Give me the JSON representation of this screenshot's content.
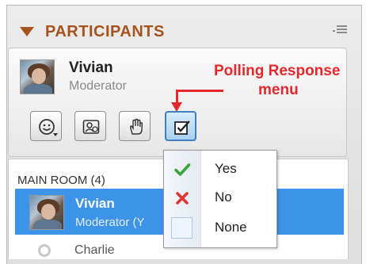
{
  "panel": {
    "title": "PARTICIPANTS",
    "colors": {
      "title": "#a5521d",
      "selection": "#3d93e8",
      "annotation": "#e4282c"
    }
  },
  "current_user": {
    "name": "Vivian",
    "role": "Moderator"
  },
  "annotation": {
    "line1": "Polling Response",
    "line2": "menu"
  },
  "toolbar": {
    "buttons": [
      {
        "icon": "emoticon-icon",
        "has_dropdown": true
      },
      {
        "icon": "profile-icon",
        "has_dropdown": false
      },
      {
        "icon": "raise-hand-icon",
        "has_dropdown": false
      },
      {
        "icon": "polling-checkbox-icon",
        "has_dropdown": false,
        "active": true
      }
    ]
  },
  "room": {
    "label": "MAIN ROOM (4)",
    "participants": [
      {
        "name": "Vivian",
        "role": "Moderator (Y",
        "selected": true
      },
      {
        "name": "Charlie",
        "role": "",
        "selected": false
      }
    ]
  },
  "poll_menu": {
    "items": [
      {
        "label": "Yes",
        "icon": "checkmark-icon"
      },
      {
        "label": "No",
        "icon": "cross-icon"
      },
      {
        "label": "None",
        "icon": "empty-box-icon"
      }
    ]
  }
}
